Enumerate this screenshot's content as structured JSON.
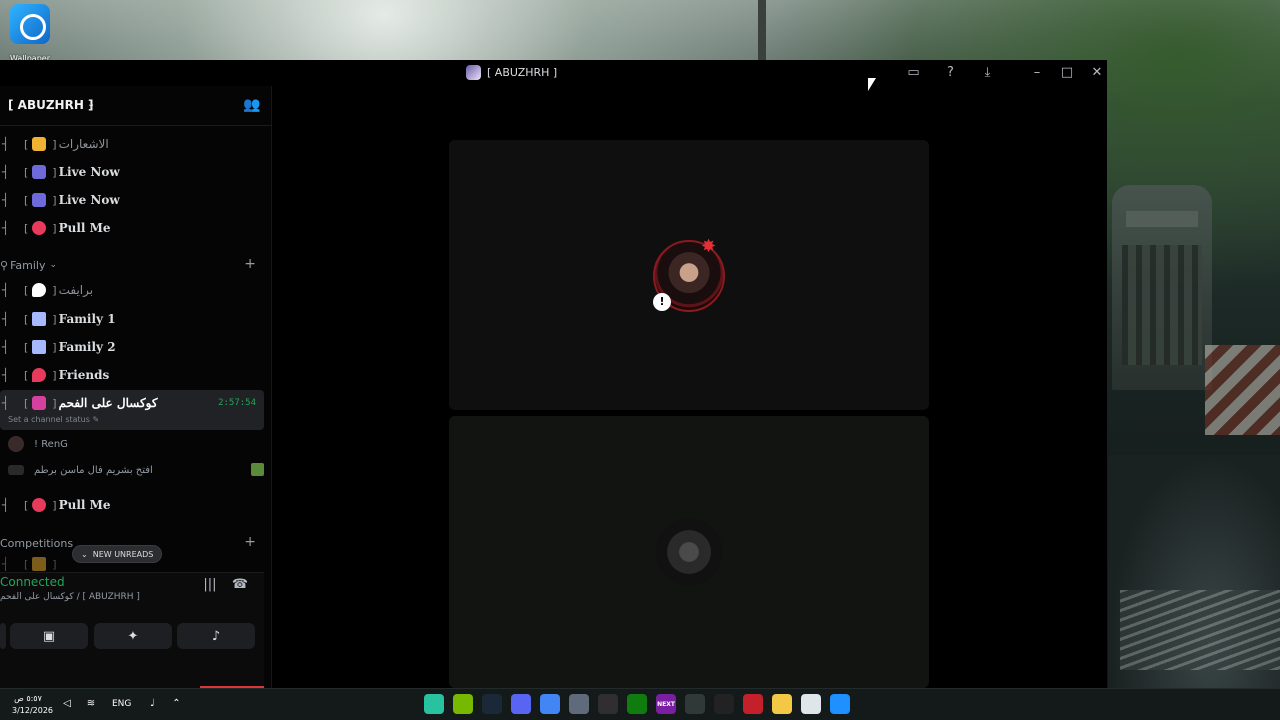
{
  "desktop": {
    "icon_label": "Wallpaper"
  },
  "window": {
    "title": "[ ABUZHRH ]",
    "title_icons": [
      "inbox-icon",
      "help-icon",
      "download-icon"
    ],
    "controls": [
      "minimize",
      "maximize",
      "close"
    ]
  },
  "sidebar": {
    "server_name": "[ ABUZHRH ]",
    "channels_top": [
      {
        "tree": "┤",
        "emoji_color": "#f0b232",
        "name": "الاشعارات",
        "style": "dim"
      },
      {
        "tree": "┤",
        "emoji_color": "#6e6ad9",
        "name": "Live Now",
        "style": "bold"
      },
      {
        "tree": "┤",
        "emoji_color": "#6e6ad9",
        "name": "Live Now",
        "style": "bold"
      },
      {
        "tree": "┤",
        "emoji_color": "#e83a5a",
        "name": "Pull Me",
        "style": "bold"
      }
    ],
    "family_category": "Family",
    "channels_family": [
      {
        "tree": "┤",
        "emoji_color": "#ffffff",
        "name": "برايفت",
        "style": "dim"
      },
      {
        "tree": "┤",
        "emoji_color": "#a6b9ff",
        "name": "Family 1",
        "style": "bold"
      },
      {
        "tree": "┤",
        "emoji_color": "#a6b9ff",
        "name": "Family 2",
        "style": "bold"
      },
      {
        "tree": "┤",
        "emoji_color": "#e83a5a",
        "name": "Friends",
        "style": "bold"
      }
    ],
    "active_channel": {
      "tree": "┤",
      "emoji_color": "#d6409f",
      "name": "كوكسال على الفحم",
      "timer": "2:57:54",
      "status_hint": "Set a channel status"
    },
    "voice_users": [
      {
        "name": "! RenG",
        "avatar_color": "#3a2a2a"
      },
      {
        "name": "افتح بشريم فال ماسن برطم",
        "avatar_color": "#2a2a2a"
      }
    ],
    "pull_me_2": {
      "tree": "┤",
      "emoji_color": "#e83a5a",
      "name": "Pull Me"
    },
    "competitions_category": "Competitions",
    "new_unreads": "NEW UNREADS",
    "voice_panel": {
      "status": "Connected",
      "subtitle": "كوكسال على الفحم / [ ABUZHRH ]",
      "buttons": [
        "screen-share-icon",
        "activities-icon",
        "soundboard-icon"
      ]
    }
  },
  "taskbar": {
    "time": "٥:٥٧ ص",
    "date": "3/12/2026",
    "language": "ENG",
    "apps": [
      {
        "name": "wallpaper-app-icon",
        "color": "#28c2a0"
      },
      {
        "name": "nvidia-icon",
        "color": "#76b900"
      },
      {
        "name": "steam-icon",
        "color": "#1b2838"
      },
      {
        "name": "discord-icon",
        "color": "#5865f2"
      },
      {
        "name": "chrome-icon",
        "color": "#4285f4"
      },
      {
        "name": "settings-icon",
        "color": "#5f6b7a"
      },
      {
        "name": "obs-icon",
        "color": "#302e31"
      },
      {
        "name": "xbox-icon",
        "color": "#107c10"
      },
      {
        "name": "next-icon",
        "color": "#7a1fa2",
        "label": "NEXT"
      },
      {
        "name": "search-icon",
        "color": "#303838"
      },
      {
        "name": "capcut-icon",
        "color": "#222222"
      },
      {
        "name": "battlenet-icon",
        "color": "#c4202b"
      },
      {
        "name": "file-explorer-icon",
        "color": "#f3c844"
      },
      {
        "name": "windows-icon",
        "color": "#dfe6ea"
      },
      {
        "name": "start-icon",
        "color": "#1e90ff"
      }
    ]
  }
}
